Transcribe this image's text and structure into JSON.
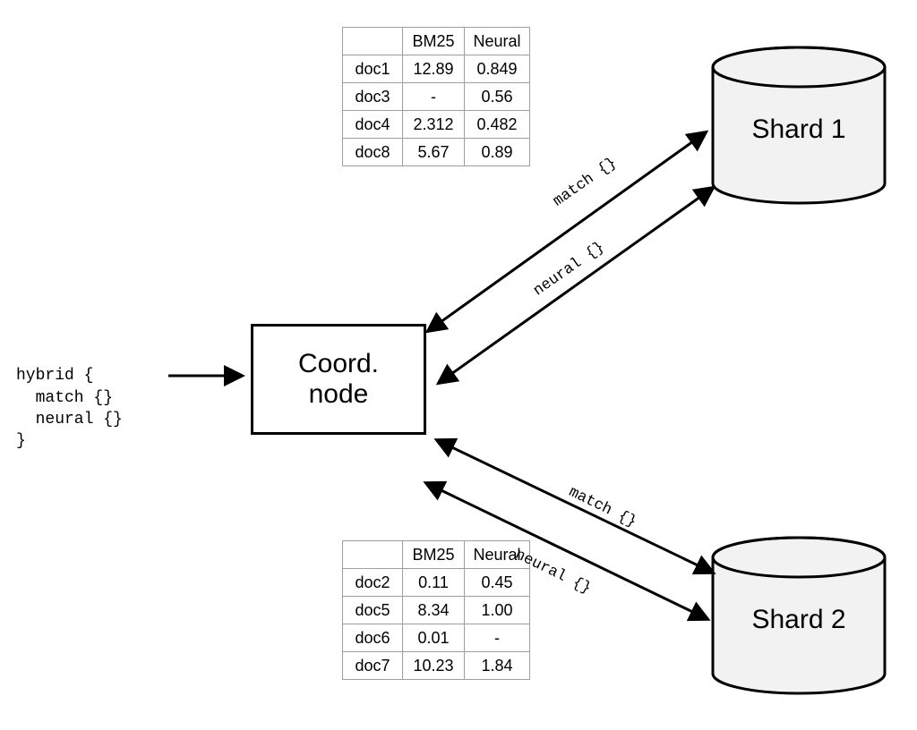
{
  "query": {
    "line1": "hybrid {",
    "line2": "  match {}",
    "line3": "  neural {}",
    "line4": "}"
  },
  "coord_label_line1": "Coord.",
  "coord_label_line2": "node",
  "shard1_label": "Shard 1",
  "shard2_label": "Shard 2",
  "edge_labels": {
    "match": "match {}",
    "neural": "neural {}"
  },
  "table_headers": {
    "bm25": "BM25",
    "neural": "Neural"
  },
  "table1": {
    "rows": [
      {
        "doc": "doc1",
        "bm25": "12.89",
        "neural": "0.849"
      },
      {
        "doc": "doc3",
        "bm25": "-",
        "neural": "0.56"
      },
      {
        "doc": "doc4",
        "bm25": "2.312",
        "neural": "0.482"
      },
      {
        "doc": "doc8",
        "bm25": "5.67",
        "neural": "0.89"
      }
    ]
  },
  "table2": {
    "rows": [
      {
        "doc": "doc2",
        "bm25": "0.11",
        "neural": "0.45"
      },
      {
        "doc": "doc5",
        "bm25": "8.34",
        "neural": "1.00"
      },
      {
        "doc": "doc6",
        "bm25": "0.01",
        "neural": "-"
      },
      {
        "doc": "doc7",
        "bm25": "10.23",
        "neural": "1.84"
      }
    ]
  }
}
